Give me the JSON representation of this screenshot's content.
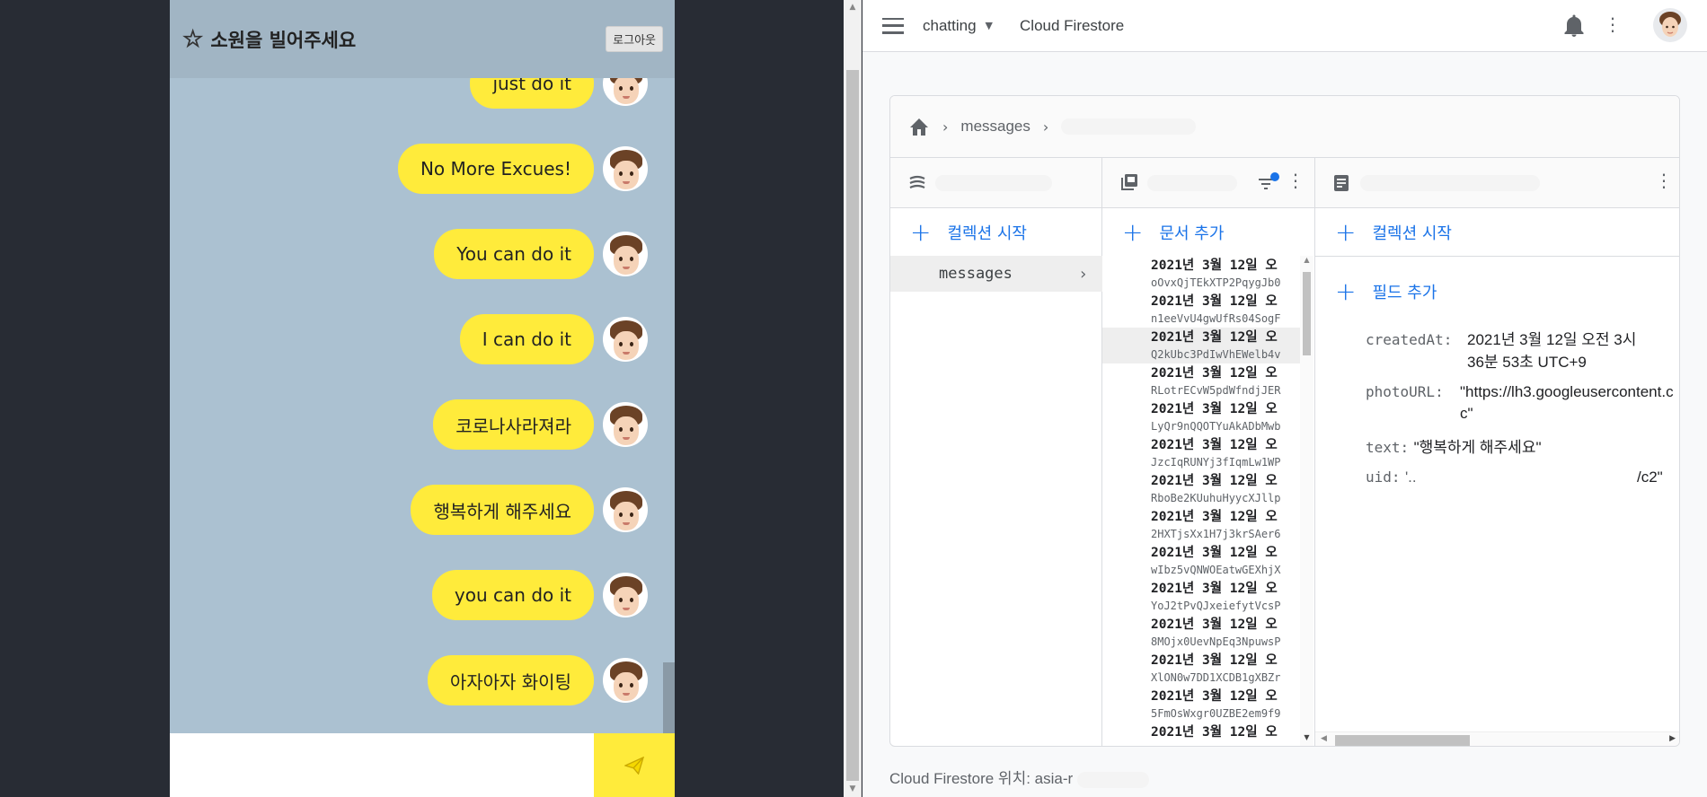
{
  "chat": {
    "title": "소원을 빌어주세요",
    "logout_label": "로그아웃",
    "messages": [
      "just do it",
      "No More Excues!",
      "You can do it",
      "I can do it",
      "코로나사라져라",
      "행복하게 해주세요",
      "you can do it",
      "아자아자 화이팅"
    ],
    "input_value": "",
    "colors": {
      "header": "#a1b5c4",
      "background": "#abc1d1",
      "bubble": "#ffeb3b"
    }
  },
  "console": {
    "project_name": "chatting",
    "product_name": "Cloud Firestore",
    "icons": [
      "menu-icon",
      "dropdown-caret-icon",
      "bell-icon",
      "more-vert-icon",
      "account-avatar"
    ],
    "breadcrumb": {
      "collection": "messages"
    },
    "col1": {
      "add_label": "컬렉션 시작",
      "collection_item": "messages"
    },
    "col2": {
      "add_label": "문서 추가",
      "documents": [
        {
          "date": "2021년 3월 12일 오",
          "id": "oOvxQjTEkXTP2PqygJb0",
          "selected": false
        },
        {
          "date": "2021년 3월 12일 오",
          "id": "n1eeVvU4gwUfRs04SogF",
          "selected": false
        },
        {
          "date": "2021년 3월 12일 오",
          "id": "Q2kUbc3PdIwVhEWelb4v",
          "selected": true
        },
        {
          "date": "2021년 3월 12일 오",
          "id": "RLotrECvW5pdWfndjJER",
          "selected": false
        },
        {
          "date": "2021년 3월 12일 오",
          "id": "LyQr9nQQOTYuAkADbMwb",
          "selected": false
        },
        {
          "date": "2021년 3월 12일 오",
          "id": "JzcIqRUNYj3fIqmLw1WP",
          "selected": false
        },
        {
          "date": "2021년 3월 12일 오",
          "id": "RboBe2KUuhuHyycXJllp",
          "selected": false
        },
        {
          "date": "2021년 3월 12일 오",
          "id": "2HXTjsXx1H7j3krSAer6",
          "selected": false
        },
        {
          "date": "2021년 3월 12일 오",
          "id": "wIbz5vQNWOEatwGEXhjX",
          "selected": false
        },
        {
          "date": "2021년 3월 12일 오",
          "id": "YoJ2tPvQJxeiefytVcsP",
          "selected": false
        },
        {
          "date": "2021년 3월 12일 오",
          "id": "8MOjx0UevNpEq3NpuwsP",
          "selected": false
        },
        {
          "date": "2021년 3월 12일 오",
          "id": "XlON0w7DD1XCDB1gXBZr",
          "selected": false
        },
        {
          "date": "2021년 3월 12일 오",
          "id": "5FmOsWxgr0UZBE2em9f9",
          "selected": false
        },
        {
          "date": "2021년 3월 12일 오",
          "id": "",
          "selected": false
        }
      ]
    },
    "col3": {
      "add_collection_label": "컬렉션 시작",
      "add_field_label": "필드 추가",
      "fields": [
        {
          "key": "createdAt:",
          "value_line1": "2021년 3월 12일 오전 3시",
          "value_line2": "36분 53초 UTC+9"
        },
        {
          "key": "photoURL:",
          "value_line1": "\"https://lh3.googleusercontent.c",
          "value_line2": "c\""
        },
        {
          "key": "text:",
          "value_line1": "\"행복하게 해주세요\""
        },
        {
          "key": "uid:",
          "value_start": "'..",
          "value_end": "/c2\""
        }
      ]
    },
    "footer": {
      "location_label": "Cloud Firestore 위치: asia-r"
    },
    "colors": {
      "accent": "#1a73e8",
      "text": "#3c4043"
    }
  }
}
